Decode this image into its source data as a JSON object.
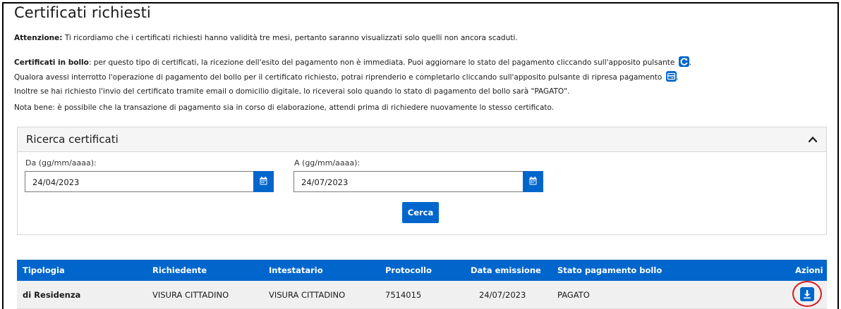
{
  "page": {
    "title": "Certificati richiesti"
  },
  "notes": {
    "attention_label": "Attenzione:",
    "attention_text": " Ti ricordiamo che i certificati richiesti hanno validità tre mesi, pertanto saranno visualizzati solo quelli non ancora scaduti.",
    "bollo_label": "Certificati in bollo",
    "bollo_text": ": per questo tipo di certificati, la ricezione dell'esito del pagamento non è immediata. Puoi aggiornare lo stato del pagamento cliccando sull'apposito pulsante",
    "interrupted_text": "Qualora avessi interrotto l'operazione di pagamento del bollo per il certificato richiesto, potrai riprenderio e completarlo cliccando sull'apposito pulsante di ripresa pagamento",
    "email_text": "Inoltre se hai richiesto l'invio del certificato tramite email o domicilio digitale, lo riceverai solo quando lo stato di pagamento del bollo sarà \"PAGATO\".",
    "nota_bene_text": "Nota bene: è possibile che la transazione di pagamento sia in corso di elaborazione, attendi prima di richiedere nuovamente lo stesso certificato.",
    "period": "."
  },
  "search": {
    "title": "Ricerca certificati",
    "from_label": "Da (gg/mm/aaaa):",
    "from_value": "24/04/2023",
    "to_label": "A (gg/mm/aaaa):",
    "to_value": "24/07/2023",
    "button_label": "Cerca"
  },
  "table": {
    "columns": [
      "Tipologia",
      "Richiedente",
      "Intestatario",
      "Protocollo",
      "Data emissione",
      "Stato pagamento bollo",
      "Azioni"
    ],
    "rows": [
      {
        "tipologia": "di Residenza",
        "richiedente": "VISURA CITTADINO",
        "intestatario": "VISURA CITTADINO",
        "protocollo": "7514015",
        "data_emissione": "24/07/2023",
        "stato": "PAGATO"
      }
    ]
  },
  "icons": {
    "refresh": "refresh-icon",
    "resume_payment": "credit-card-icon",
    "calendar": "calendar-icon",
    "chevron": "chevron-up-icon",
    "download": "download-icon"
  },
  "colors": {
    "primary": "#0066cc",
    "highlight": "#d91a1a"
  }
}
